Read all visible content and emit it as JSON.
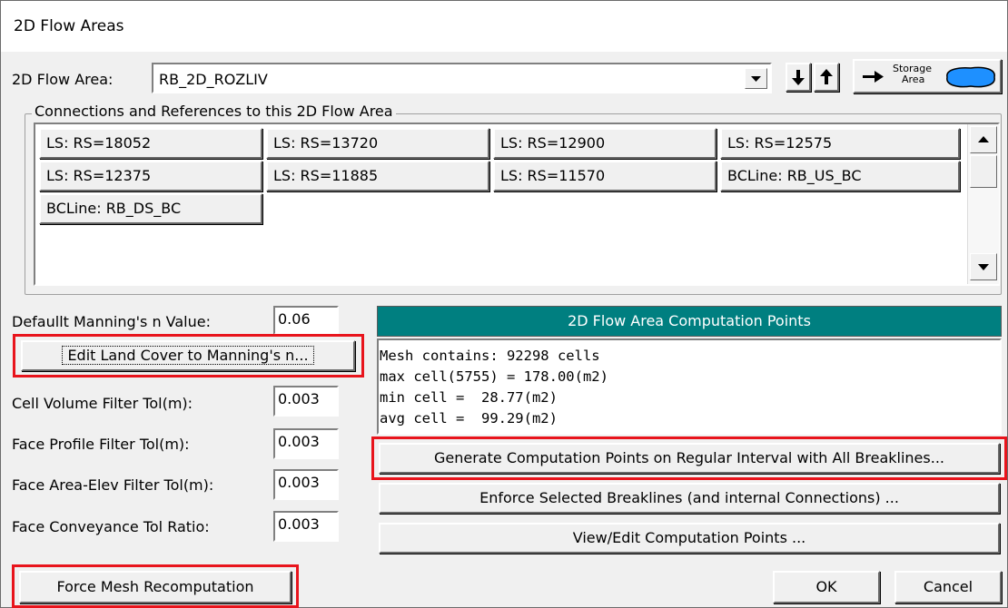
{
  "window": {
    "title": "2D Flow Areas"
  },
  "flow_area": {
    "label": "2D Flow Area:",
    "value": "RB_2D_ROZLIV",
    "storage_button_label_top": "Storage",
    "storage_button_label_bottom": "Area",
    "storage_color": "#1e90ff"
  },
  "connections": {
    "title": "Connections and References to this 2D Flow Area",
    "items": [
      "LS: RS=18052",
      "LS: RS=13720",
      "LS: RS=12900",
      "LS: RS=12575",
      "LS: RS=12375",
      "LS: RS=11885",
      "LS: RS=11570",
      "BCLine: RB_US_BC",
      "BCLine: RB_DS_BC"
    ]
  },
  "manning": {
    "label": "Defaullt Manning's n Value:",
    "value": "0.06",
    "edit_button": "Edit Land Cover to Manning's n..."
  },
  "filters": [
    {
      "label": "Cell Volume Filter Tol(m):",
      "value": "0.003"
    },
    {
      "label": "Face Profile Filter Tol(m):",
      "value": "0.003"
    },
    {
      "label": "Face Area-Elev Filter Tol(m):",
      "value": "0.003"
    },
    {
      "label": "Face Conveyance Tol Ratio:",
      "value": "0.003"
    }
  ],
  "computation": {
    "header": "2D Flow Area Computation Points",
    "header_color": "#007f80",
    "lines": [
      "Mesh contains: 92298 cells",
      "max cell(5755) = 178.00(m2)",
      "min cell =  28.77(m2)",
      "avg cell =  99.29(m2)"
    ],
    "generate_button": "Generate Computation Points on Regular Interval with All Breaklines...",
    "enforce_button": "Enforce Selected Breaklines (and internal Connections) ...",
    "view_button": "View/Edit Computation Points ..."
  },
  "footer": {
    "force_button": "Force Mesh Recomputation",
    "ok_button": "OK",
    "cancel_button": "Cancel"
  },
  "highlight_color": "#e8141c"
}
